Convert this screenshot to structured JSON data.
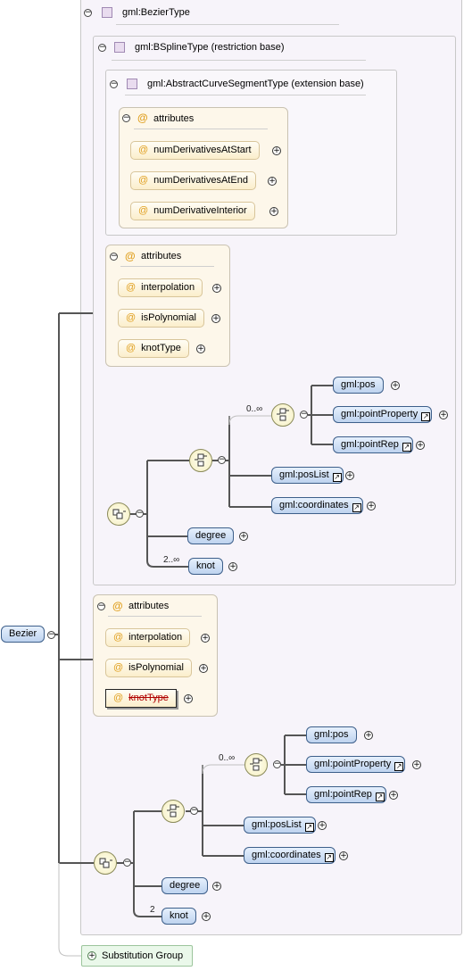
{
  "root": {
    "name": "Bezier"
  },
  "base_type": {
    "name": "gml:BezierType"
  },
  "restriction_base": {
    "name": "gml:BSplineType (restriction base)"
  },
  "extension_base": {
    "name": "gml:AbstractCurveSegmentType (extension base)"
  },
  "inner_attributes": {
    "label": "attributes",
    "items": [
      "numDerivativesAtStart",
      "numDerivativesAtEnd",
      "numDerivativeInterior"
    ]
  },
  "bspline_attributes": {
    "label": "attributes",
    "items": [
      "interpolation",
      "isPolynomial",
      "knotType"
    ]
  },
  "bspline_model": {
    "choice_occurrence": "0..∞",
    "elements": [
      "gml:pos",
      "gml:pointProperty",
      "gml:pointRep",
      "gml:posList",
      "gml:coordinates",
      "degree",
      "knot"
    ],
    "knot_occurrence": "2..∞"
  },
  "bezier_attributes": {
    "label": "attributes",
    "items": [
      "interpolation",
      "isPolynomial",
      "knotType"
    ],
    "prohibited": "knotType"
  },
  "bezier_model": {
    "choice_occurrence": "0..∞",
    "elements": [
      "gml:pos",
      "gml:pointProperty",
      "gml:pointRep",
      "gml:posList",
      "gml:coordinates",
      "degree",
      "knot"
    ],
    "knot_occurrence": "2"
  },
  "substitution_group": {
    "label": "Substitution Group"
  },
  "icons": {
    "collapse": "minus-circle-icon",
    "expand": "plus-circle-icon",
    "attribute": "at-sign-icon",
    "type": "type-square-icon",
    "sequence": "sequence-compositor-icon",
    "choice": "choice-compositor-icon",
    "reference": "reference-arrow-icon"
  },
  "colors": {
    "element_fill": "#bed3ef",
    "element_border": "#3d5f8a",
    "attribute_fill": "#fbeecb",
    "type_box": "#f7f4fa",
    "attr_box": "#fdf7ea",
    "prohibited_text": "#b00000",
    "substitution_fill": "#eaf8ea"
  }
}
